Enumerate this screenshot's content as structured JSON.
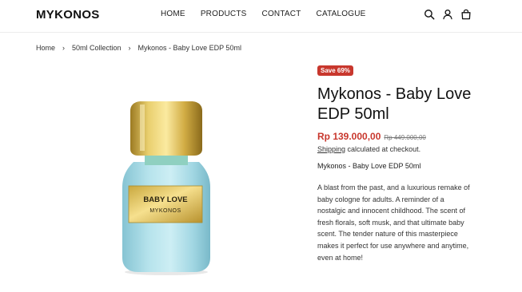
{
  "header": {
    "logo": "MYKONOS",
    "nav": [
      "HOME",
      "PRODUCTS",
      "CONTACT",
      "CATALOGUE"
    ]
  },
  "icons": [
    "search-icon",
    "account-icon",
    "cart-icon"
  ],
  "breadcrumb": {
    "items": [
      "Home",
      "50ml Collection",
      "Mykonos - Baby Love EDP 50ml"
    ],
    "separator": "›"
  },
  "product": {
    "badge": "Save 69%",
    "title": "Mykonos - Baby Love EDP 50ml",
    "price": "Rp 139.000,00",
    "compare_price": "Rp 449.000,00",
    "shipping_link": "Shipping",
    "shipping_text": " calculated at checkout.",
    "subtitle": "Mykonos - Baby Love EDP 50ml",
    "description": "A blast from the past, and a luxurious remake of baby cologne for adults. A reminder of a nostalgic and innocent childhood. The scent of fresh florals, soft musk, and that ultimate baby scent. The tender nature of this masterpiece makes it perfect for use anywhere and anytime, even at home!",
    "label_line1": "BABY LOVE",
    "label_line2": "MYKONOS"
  },
  "colors": {
    "accent": "#c8372d",
    "bottle": "#a9dbe6",
    "cap": "#d4b24a"
  }
}
